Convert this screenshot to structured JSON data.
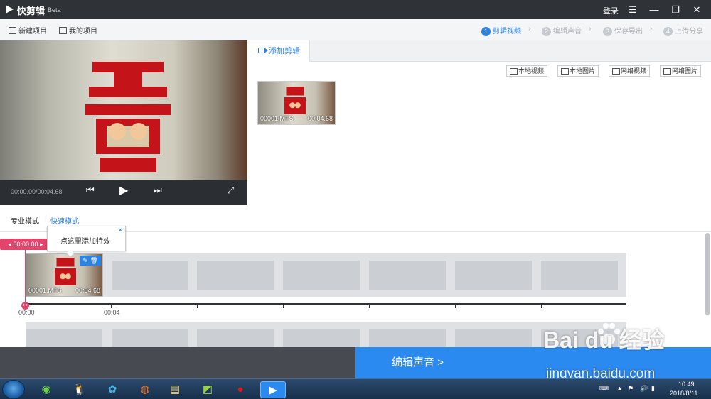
{
  "app": {
    "name": "快剪辑",
    "badge": "Beta",
    "login": "登录"
  },
  "window_controls": {
    "menu": "☰",
    "minimize": "—",
    "maximize": "❐",
    "close": "✕"
  },
  "toolbar": {
    "new_project": "新建项目",
    "my_projects": "我的项目"
  },
  "steps": [
    {
      "num": "1",
      "label": "剪辑视频"
    },
    {
      "num": "2",
      "label": "编辑声音"
    },
    {
      "num": "3",
      "label": "保存导出"
    },
    {
      "num": "4",
      "label": "上传分享"
    }
  ],
  "preview": {
    "time": "00:00.00/00:04.68"
  },
  "panel": {
    "tab": "添加剪辑"
  },
  "sources": {
    "local_video": "本地视频",
    "local_image": "本地图片",
    "web_video": "网络视频",
    "web_image": "网络图片"
  },
  "media": {
    "filename": "00001.MTS",
    "duration": "00:04.68"
  },
  "modes": {
    "pro": "专业模式",
    "quick": "快速模式"
  },
  "timeline": {
    "playhead": "00:00.00",
    "tick0": "00:00",
    "tick1": "00:04",
    "clip_name": "00001.MTS",
    "clip_duration": "00:04.68"
  },
  "tooltip": {
    "text": "点这里添加特效"
  },
  "next": {
    "label": "编辑声音 >"
  },
  "watermark": {
    "main": "Bai du 经验",
    "url": "jingyan.baidu.com"
  },
  "taskbar": {
    "time": "10:49",
    "date": "2018/8/11"
  }
}
